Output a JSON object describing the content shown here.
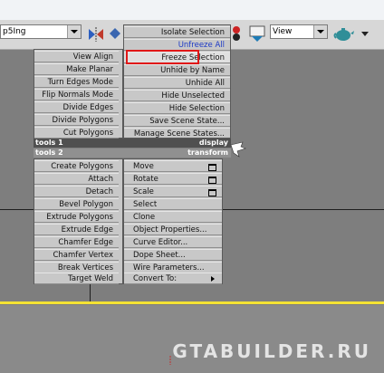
{
  "toolbar": {
    "selection_combo": "p5Ing",
    "view_combo": "View"
  },
  "quad_right_top": [
    {
      "label": "Isolate Selection",
      "color": "#111111"
    },
    {
      "label": "Unfreeze All",
      "color": "#1d3ac6"
    },
    {
      "label": "Freeze Selection",
      "highlighted": true
    },
    {
      "label": "Unhide by Name"
    },
    {
      "label": "Unhide All"
    },
    {
      "label": "Hide Unselected"
    },
    {
      "label": "Hide Selection"
    },
    {
      "label": "Save Scene State..."
    },
    {
      "label": "Manage Scene States..."
    }
  ],
  "quad_left_top": [
    {
      "label": "View Align"
    },
    {
      "label": "Make Planar"
    },
    {
      "label": "Turn Edges Mode"
    },
    {
      "label": "Flip Normals Mode"
    },
    {
      "label": "Divide Edges"
    },
    {
      "label": "Divide Polygons"
    },
    {
      "label": "Cut Polygons"
    }
  ],
  "quad_titles": {
    "tools1": "tools 1",
    "display": "display",
    "tools2": "tools 2",
    "transform": "transform"
  },
  "quad_left_bottom": [
    {
      "label": "Create Polygons"
    },
    {
      "label": "Attach"
    },
    {
      "label": "Detach"
    },
    {
      "label": "Bevel Polygon"
    },
    {
      "label": "Extrude Polygons"
    },
    {
      "label": "Extrude Edge"
    },
    {
      "label": "Chamfer Edge"
    },
    {
      "label": "Chamfer Vertex"
    },
    {
      "label": "Break Vertices"
    },
    {
      "label": "Target Weld"
    }
  ],
  "quad_right_bottom": [
    {
      "label": "Move",
      "has_settings": true
    },
    {
      "label": "Rotate",
      "has_settings": true
    },
    {
      "label": "Scale",
      "has_settings": true
    },
    {
      "label": "Select"
    },
    {
      "label": "Clone"
    },
    {
      "label": "Object Properties..."
    },
    {
      "label": "Curve Editor..."
    },
    {
      "label": "Dope Sheet..."
    },
    {
      "label": "Wire Parameters..."
    },
    {
      "label": "Convert To:",
      "has_submenu": true
    }
  ],
  "watermark": "GTABUILDER.RU",
  "colors": {
    "highlight_border": "#e01818",
    "viewport_border": "#f4e233",
    "menu_bg": "#c8c8c8",
    "menu_title_bg": "#505050"
  }
}
